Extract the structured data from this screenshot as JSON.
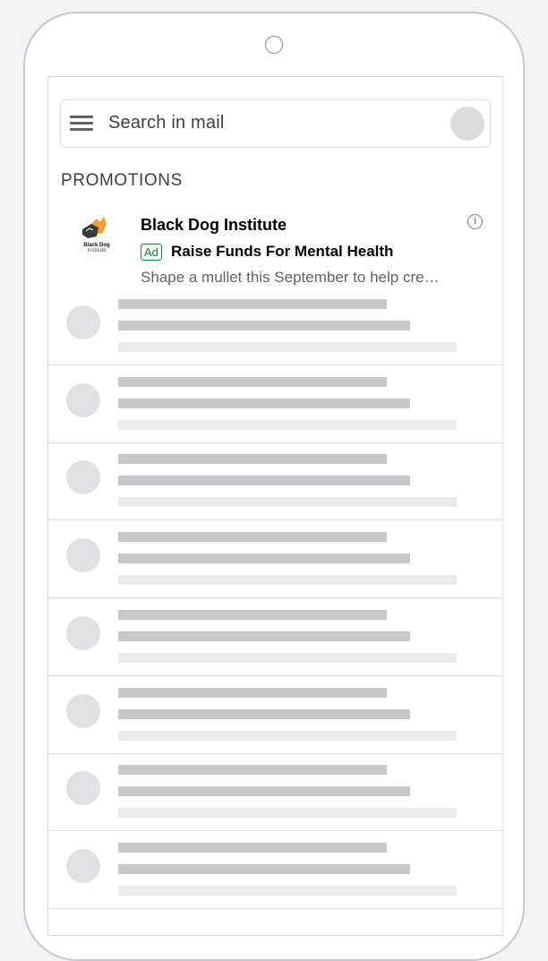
{
  "search": {
    "placeholder": "Search in mail"
  },
  "section": {
    "label": "PROMOTIONS"
  },
  "ad": {
    "logo_line1": "Black Dog",
    "logo_line2": "Institute",
    "sender": "Black Dog Institute",
    "badge": "Ad",
    "subject": "Raise Funds For Mental Health",
    "snippet": "Shape a mullet this September to help cre…",
    "info_icon": "info-icon"
  },
  "placeholder_rows": 8,
  "colors": {
    "ad_badge": "#188038",
    "skeleton_dark": "#c6c8cb",
    "skeleton_light": "#eaebed",
    "avatar": "#dadce0"
  }
}
